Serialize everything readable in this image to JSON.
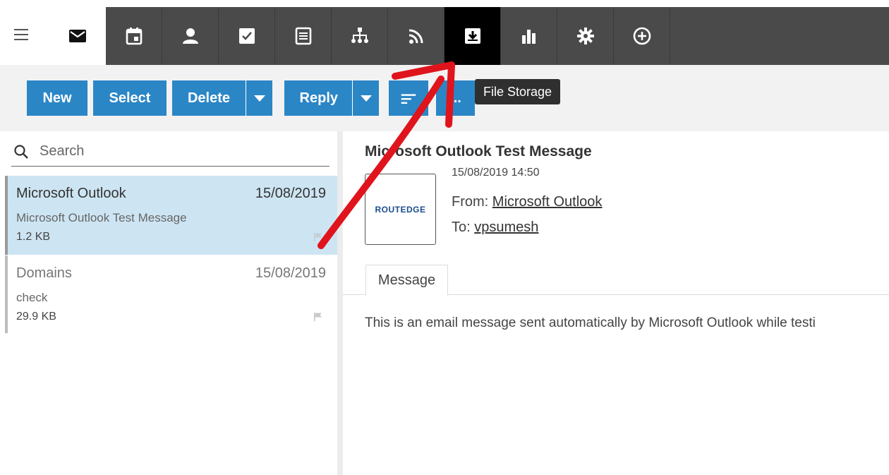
{
  "nav": {
    "tabs": [
      {
        "name": "mail",
        "icon": "mail-icon",
        "active": true
      },
      {
        "name": "calendar",
        "icon": "calendar-icon"
      },
      {
        "name": "contacts",
        "icon": "contact-icon"
      },
      {
        "name": "tasks",
        "icon": "checkbox-icon"
      },
      {
        "name": "notes",
        "icon": "notes-icon"
      },
      {
        "name": "network",
        "icon": "sitemap-icon"
      },
      {
        "name": "rss",
        "icon": "rss-icon"
      },
      {
        "name": "file-storage",
        "icon": "file-storage-icon",
        "hovered": true
      },
      {
        "name": "reports",
        "icon": "bar-chart-icon"
      },
      {
        "name": "settings",
        "icon": "gear-icon"
      },
      {
        "name": "add",
        "icon": "plus-circle-icon"
      }
    ],
    "colors": {
      "bar": "#4a4a4a",
      "active": "#000000"
    }
  },
  "toolbar": {
    "new_label": "New",
    "select_label": "Select",
    "delete_label": "Delete",
    "reply_label": "Reply",
    "more_label": "...",
    "accent": "#2b86c6"
  },
  "tooltip": {
    "text": "File Storage"
  },
  "search": {
    "placeholder": "Search"
  },
  "messages": [
    {
      "from": "Microsoft Outlook",
      "date": "15/08/2019",
      "subject": "Microsoft Outlook Test Message",
      "size": "1.2 KB",
      "selected": true
    },
    {
      "from": "Domains",
      "date": "15/08/2019",
      "subject": "check",
      "size": "29.9 KB",
      "selected": false
    }
  ],
  "reading": {
    "subject": "Microsoft Outlook Test Message",
    "date": "15/08/2019 14:50",
    "from_label": "From: ",
    "from_name": "Microsoft Outlook",
    "to_label": "To: ",
    "to_name": "vpsumesh",
    "logo_text": "ROUTEDGE",
    "tab_label": "Message",
    "body": "This is an email message sent automatically by Microsoft Outlook while testi"
  }
}
